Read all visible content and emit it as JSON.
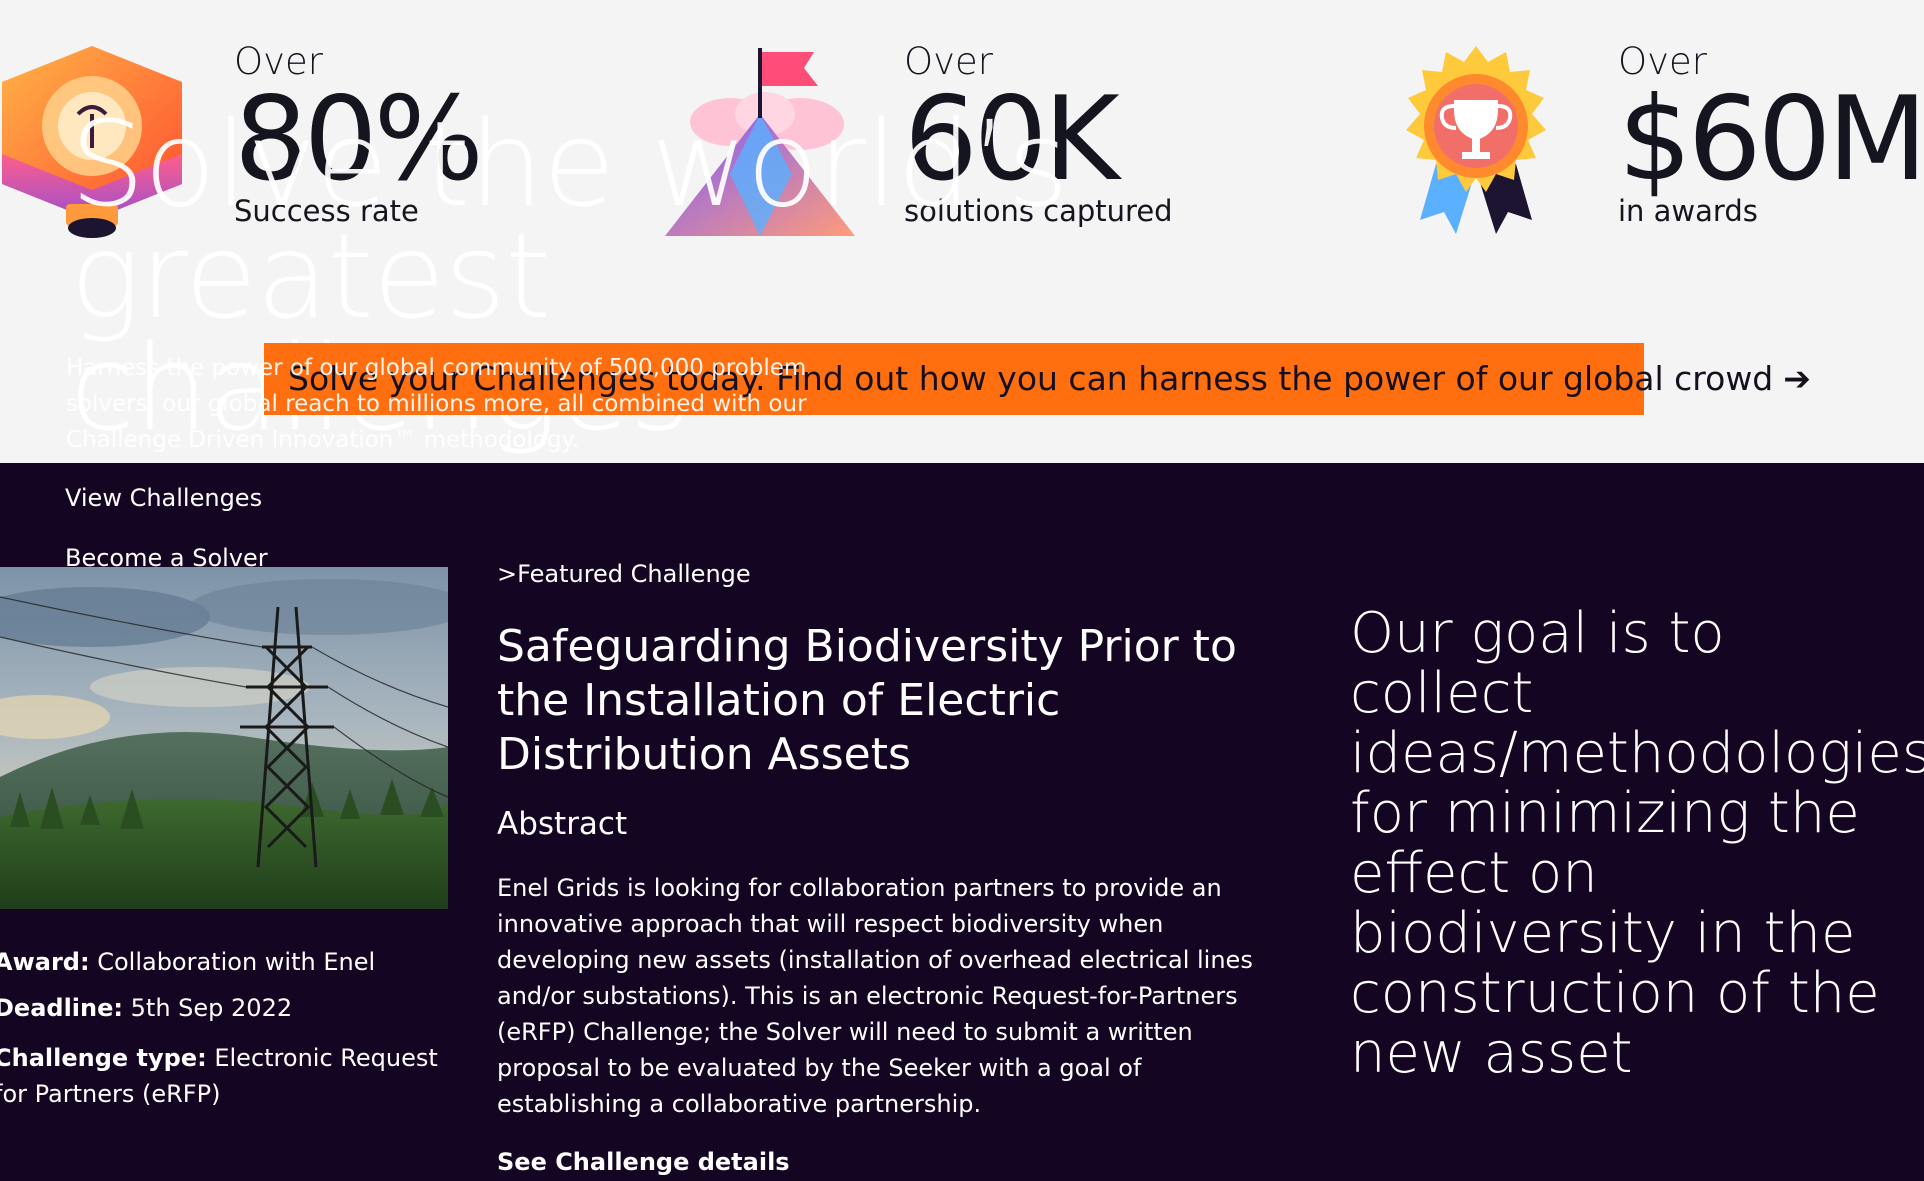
{
  "stats": [
    {
      "over": "Over",
      "value": "80%",
      "label": "Success rate",
      "icon": "lightbulb-cube-icon"
    },
    {
      "over": "Over",
      "value": "60K",
      "label": "solutions captured",
      "icon": "mountain-flag-icon"
    },
    {
      "over": "Over",
      "value": "$60M",
      "label": "in awards",
      "icon": "trophy-medal-icon"
    }
  ],
  "hero": {
    "title_line1": "Solve the world’s greatest",
    "title_line2": "challenges",
    "description": "Harness the power of our global community of 500,000 problem solvers, our global reach to millions more, all combined with our Challenge Driven Innovation™ methodology."
  },
  "cta": {
    "label": "Solve your Challenges today. Find out how you can harness the power of our global crowd",
    "arrow": "➔"
  },
  "nav": {
    "view_challenges": "View Challenges",
    "become_solver": "Become a Solver"
  },
  "featured": {
    "label": ">Featured Challenge",
    "title": "Safeguarding Biodiversity Prior to the Installation of Electric Distribution Assets",
    "abstract_heading": "Abstract",
    "abstract_text": "Enel Grids is looking for collaboration partners to provide an innovative approach that will respect biodiversity when developing new assets (installation of overhead electrical lines and/or substations). This is an electronic Request-for-Partners (eRFP) Challenge; the Solver will need to submit a written proposal to be evaluated by the Seeker with a goal of establishing a collaborative partnership.",
    "details_link": "See Challenge details",
    "award_label": "Award:",
    "award_value": "Collaboration with Enel",
    "deadline_label": "Deadline:",
    "deadline_value": "5th Sep 2022",
    "type_label": "Challenge type:",
    "type_value": "Electronic Request for Partners (eRFP)",
    "goal": "Our goal is to collect ideas/methodologies for minimizing the effect on biodiversity in the construction of the new asset"
  },
  "colors": {
    "accent_orange": "#ff6f0f",
    "dark_background": "#140523",
    "light_background": "#f4f4f4"
  }
}
